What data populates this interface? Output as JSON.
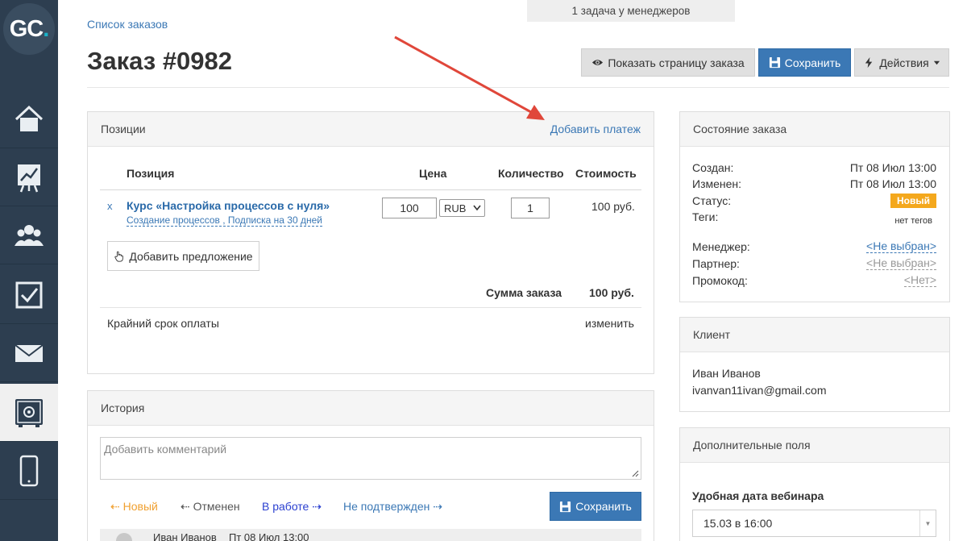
{
  "logo": {
    "text": "GC",
    "dot": "."
  },
  "sidebar": {
    "items": [
      {
        "icon": "home-icon"
      },
      {
        "icon": "chart-board-icon"
      },
      {
        "icon": "users-icon"
      },
      {
        "icon": "checkbox-icon"
      },
      {
        "icon": "mail-icon"
      },
      {
        "icon": "safe-icon",
        "active": true
      },
      {
        "icon": "phone-icon"
      }
    ]
  },
  "header": {
    "breadcrumb": "Список заказов",
    "notice": "1 задача у менеджеров",
    "title": "Заказ #0982",
    "show_page_label": "Показать страницу заказа",
    "save_label": "Сохранить",
    "actions_label": "Действия"
  },
  "positions": {
    "title": "Позиции",
    "add_payment": "Добавить платеж",
    "columns": {
      "position": "Позиция",
      "price": "Цена",
      "quantity": "Количество",
      "cost": "Стоимость"
    },
    "row": {
      "remove": "x",
      "name": "Курс «Настройка процессов с нуля»",
      "subtitle": "Создание процессов , Подписка на 30 дней",
      "price": "100",
      "currency": "RUB",
      "quantity": "1",
      "cost": "100 руб."
    },
    "add_offer": "Добавить предложение",
    "total_label": "Сумма заказа",
    "total_value": "100 руб.",
    "deadline_label": "Крайний срок оплаты",
    "deadline_change": "изменить"
  },
  "history": {
    "title": "История",
    "comment_placeholder": "Добавить комментарий",
    "status_new": "Новый",
    "status_cancelled": "Отменен",
    "status_in_work": "В работе",
    "status_unconfirmed": "Не подтвержден",
    "save_label": "Сохранить",
    "entry_author": "Иван Иванов",
    "entry_date": "Пт 08 Июл 13:00"
  },
  "order_state": {
    "title": "Состояние заказа",
    "created_label": "Создан:",
    "created_value": "Пт 08 Июл 13:00",
    "changed_label": "Изменен:",
    "changed_value": "Пт 08 Июл 13:00",
    "status_label": "Статус:",
    "status_value": "Новый",
    "tags_label": "Теги:",
    "tags_value": "нет тегов",
    "manager_label": "Менеджер:",
    "manager_value": "<Не выбран>",
    "partner_label": "Партнер:",
    "partner_value": "<Не выбран>",
    "promo_label": "Промокод:",
    "promo_value": "<Нет>"
  },
  "client": {
    "title": "Клиент",
    "name": "Иван Иванов",
    "email": "ivanvan11ivan@gmail.com"
  },
  "extra_fields": {
    "title": "Дополнительные поля",
    "webinar_label": "Удобная дата вебинара",
    "webinar_value": "15.03 в 16:00"
  },
  "colors": {
    "sidebar": "#2d3e50",
    "accent": "#3b78b5",
    "status_new": "#f4a81d",
    "annotation_arrow": "#e0473a"
  }
}
